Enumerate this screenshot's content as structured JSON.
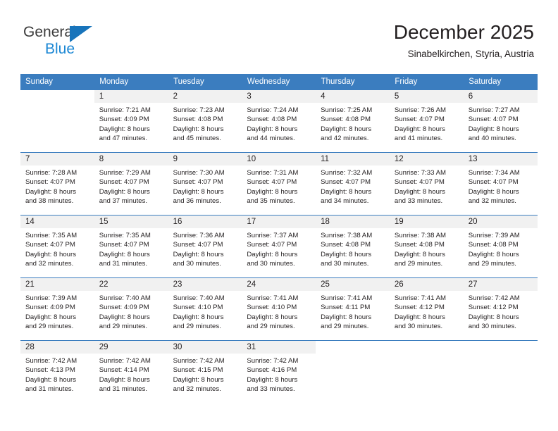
{
  "brand": {
    "name_part1": "General",
    "name_part2": "Blue",
    "logo_icon": "triangle-logo"
  },
  "header": {
    "month_title": "December 2025",
    "location": "Sinabelkirchen, Styria, Austria"
  },
  "calendar": {
    "weekday_headers": [
      "Sunday",
      "Monday",
      "Tuesday",
      "Wednesday",
      "Thursday",
      "Friday",
      "Saturday"
    ],
    "accent_color": "#3b7dbf",
    "daynum_bg": "#f1f1f1",
    "weeks": [
      [
        {
          "day": "",
          "sunrise": "",
          "sunset": "",
          "daylight_l1": "",
          "daylight_l2": "",
          "blank": true
        },
        {
          "day": "1",
          "sunrise": "Sunrise: 7:21 AM",
          "sunset": "Sunset: 4:09 PM",
          "daylight_l1": "Daylight: 8 hours",
          "daylight_l2": "and 47 minutes."
        },
        {
          "day": "2",
          "sunrise": "Sunrise: 7:23 AM",
          "sunset": "Sunset: 4:08 PM",
          "daylight_l1": "Daylight: 8 hours",
          "daylight_l2": "and 45 minutes."
        },
        {
          "day": "3",
          "sunrise": "Sunrise: 7:24 AM",
          "sunset": "Sunset: 4:08 PM",
          "daylight_l1": "Daylight: 8 hours",
          "daylight_l2": "and 44 minutes."
        },
        {
          "day": "4",
          "sunrise": "Sunrise: 7:25 AM",
          "sunset": "Sunset: 4:08 PM",
          "daylight_l1": "Daylight: 8 hours",
          "daylight_l2": "and 42 minutes."
        },
        {
          "day": "5",
          "sunrise": "Sunrise: 7:26 AM",
          "sunset": "Sunset: 4:07 PM",
          "daylight_l1": "Daylight: 8 hours",
          "daylight_l2": "and 41 minutes."
        },
        {
          "day": "6",
          "sunrise": "Sunrise: 7:27 AM",
          "sunset": "Sunset: 4:07 PM",
          "daylight_l1": "Daylight: 8 hours",
          "daylight_l2": "and 40 minutes."
        }
      ],
      [
        {
          "day": "7",
          "sunrise": "Sunrise: 7:28 AM",
          "sunset": "Sunset: 4:07 PM",
          "daylight_l1": "Daylight: 8 hours",
          "daylight_l2": "and 38 minutes."
        },
        {
          "day": "8",
          "sunrise": "Sunrise: 7:29 AM",
          "sunset": "Sunset: 4:07 PM",
          "daylight_l1": "Daylight: 8 hours",
          "daylight_l2": "and 37 minutes."
        },
        {
          "day": "9",
          "sunrise": "Sunrise: 7:30 AM",
          "sunset": "Sunset: 4:07 PM",
          "daylight_l1": "Daylight: 8 hours",
          "daylight_l2": "and 36 minutes."
        },
        {
          "day": "10",
          "sunrise": "Sunrise: 7:31 AM",
          "sunset": "Sunset: 4:07 PM",
          "daylight_l1": "Daylight: 8 hours",
          "daylight_l2": "and 35 minutes."
        },
        {
          "day": "11",
          "sunrise": "Sunrise: 7:32 AM",
          "sunset": "Sunset: 4:07 PM",
          "daylight_l1": "Daylight: 8 hours",
          "daylight_l2": "and 34 minutes."
        },
        {
          "day": "12",
          "sunrise": "Sunrise: 7:33 AM",
          "sunset": "Sunset: 4:07 PM",
          "daylight_l1": "Daylight: 8 hours",
          "daylight_l2": "and 33 minutes."
        },
        {
          "day": "13",
          "sunrise": "Sunrise: 7:34 AM",
          "sunset": "Sunset: 4:07 PM",
          "daylight_l1": "Daylight: 8 hours",
          "daylight_l2": "and 32 minutes."
        }
      ],
      [
        {
          "day": "14",
          "sunrise": "Sunrise: 7:35 AM",
          "sunset": "Sunset: 4:07 PM",
          "daylight_l1": "Daylight: 8 hours",
          "daylight_l2": "and 32 minutes."
        },
        {
          "day": "15",
          "sunrise": "Sunrise: 7:35 AM",
          "sunset": "Sunset: 4:07 PM",
          "daylight_l1": "Daylight: 8 hours",
          "daylight_l2": "and 31 minutes."
        },
        {
          "day": "16",
          "sunrise": "Sunrise: 7:36 AM",
          "sunset": "Sunset: 4:07 PM",
          "daylight_l1": "Daylight: 8 hours",
          "daylight_l2": "and 30 minutes."
        },
        {
          "day": "17",
          "sunrise": "Sunrise: 7:37 AM",
          "sunset": "Sunset: 4:07 PM",
          "daylight_l1": "Daylight: 8 hours",
          "daylight_l2": "and 30 minutes."
        },
        {
          "day": "18",
          "sunrise": "Sunrise: 7:38 AM",
          "sunset": "Sunset: 4:08 PM",
          "daylight_l1": "Daylight: 8 hours",
          "daylight_l2": "and 30 minutes."
        },
        {
          "day": "19",
          "sunrise": "Sunrise: 7:38 AM",
          "sunset": "Sunset: 4:08 PM",
          "daylight_l1": "Daylight: 8 hours",
          "daylight_l2": "and 29 minutes."
        },
        {
          "day": "20",
          "sunrise": "Sunrise: 7:39 AM",
          "sunset": "Sunset: 4:08 PM",
          "daylight_l1": "Daylight: 8 hours",
          "daylight_l2": "and 29 minutes."
        }
      ],
      [
        {
          "day": "21",
          "sunrise": "Sunrise: 7:39 AM",
          "sunset": "Sunset: 4:09 PM",
          "daylight_l1": "Daylight: 8 hours",
          "daylight_l2": "and 29 minutes."
        },
        {
          "day": "22",
          "sunrise": "Sunrise: 7:40 AM",
          "sunset": "Sunset: 4:09 PM",
          "daylight_l1": "Daylight: 8 hours",
          "daylight_l2": "and 29 minutes."
        },
        {
          "day": "23",
          "sunrise": "Sunrise: 7:40 AM",
          "sunset": "Sunset: 4:10 PM",
          "daylight_l1": "Daylight: 8 hours",
          "daylight_l2": "and 29 minutes."
        },
        {
          "day": "24",
          "sunrise": "Sunrise: 7:41 AM",
          "sunset": "Sunset: 4:10 PM",
          "daylight_l1": "Daylight: 8 hours",
          "daylight_l2": "and 29 minutes."
        },
        {
          "day": "25",
          "sunrise": "Sunrise: 7:41 AM",
          "sunset": "Sunset: 4:11 PM",
          "daylight_l1": "Daylight: 8 hours",
          "daylight_l2": "and 29 minutes."
        },
        {
          "day": "26",
          "sunrise": "Sunrise: 7:41 AM",
          "sunset": "Sunset: 4:12 PM",
          "daylight_l1": "Daylight: 8 hours",
          "daylight_l2": "and 30 minutes."
        },
        {
          "day": "27",
          "sunrise": "Sunrise: 7:42 AM",
          "sunset": "Sunset: 4:12 PM",
          "daylight_l1": "Daylight: 8 hours",
          "daylight_l2": "and 30 minutes."
        }
      ],
      [
        {
          "day": "28",
          "sunrise": "Sunrise: 7:42 AM",
          "sunset": "Sunset: 4:13 PM",
          "daylight_l1": "Daylight: 8 hours",
          "daylight_l2": "and 31 minutes."
        },
        {
          "day": "29",
          "sunrise": "Sunrise: 7:42 AM",
          "sunset": "Sunset: 4:14 PM",
          "daylight_l1": "Daylight: 8 hours",
          "daylight_l2": "and 31 minutes."
        },
        {
          "day": "30",
          "sunrise": "Sunrise: 7:42 AM",
          "sunset": "Sunset: 4:15 PM",
          "daylight_l1": "Daylight: 8 hours",
          "daylight_l2": "and 32 minutes."
        },
        {
          "day": "31",
          "sunrise": "Sunrise: 7:42 AM",
          "sunset": "Sunset: 4:16 PM",
          "daylight_l1": "Daylight: 8 hours",
          "daylight_l2": "and 33 minutes."
        },
        {
          "day": "",
          "sunrise": "",
          "sunset": "",
          "daylight_l1": "",
          "daylight_l2": "",
          "blank": true
        },
        {
          "day": "",
          "sunrise": "",
          "sunset": "",
          "daylight_l1": "",
          "daylight_l2": "",
          "blank": true
        },
        {
          "day": "",
          "sunrise": "",
          "sunset": "",
          "daylight_l1": "",
          "daylight_l2": "",
          "blank": true
        }
      ]
    ]
  }
}
